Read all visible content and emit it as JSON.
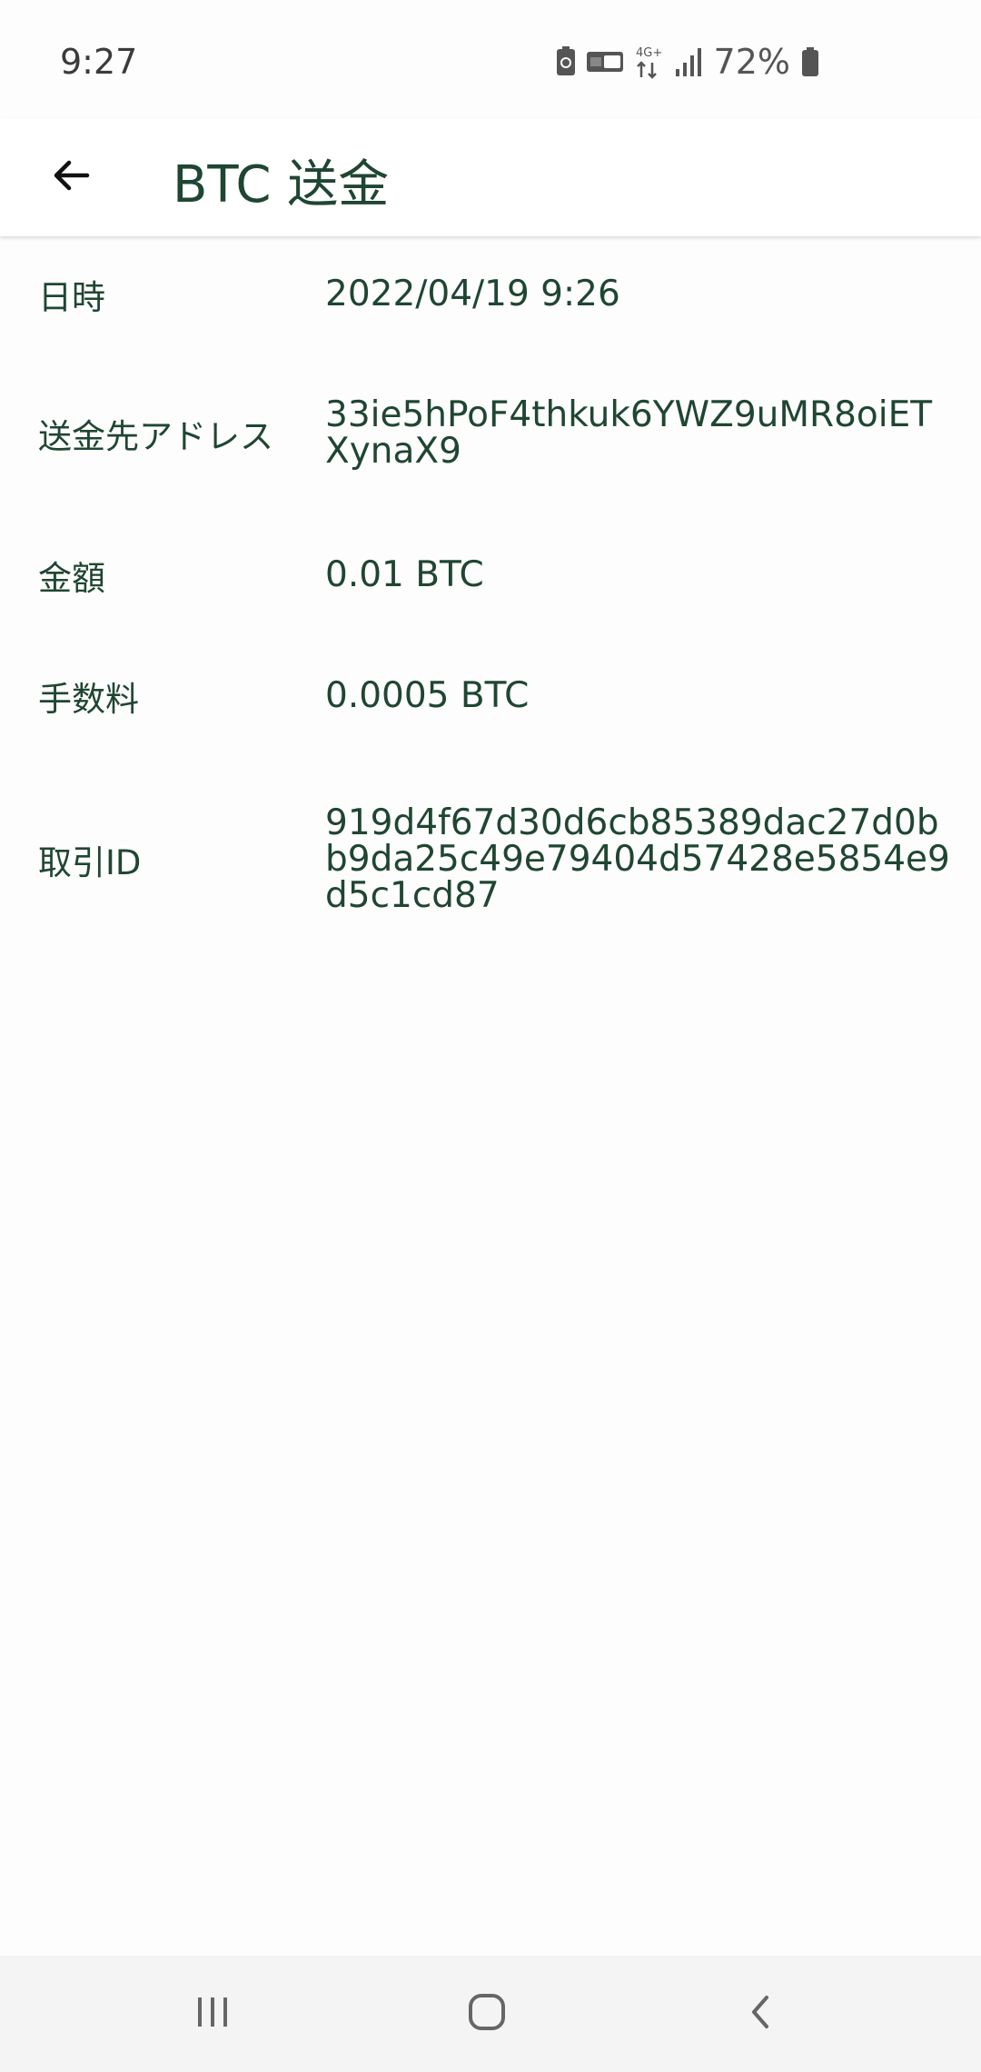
{
  "status_bar": {
    "time": "9:27",
    "battery_percent": "72%",
    "network_label": "4G+",
    "icons": [
      "sim-icon",
      "volte-icon",
      "network-4g-icon",
      "signal-icon",
      "battery-icon"
    ]
  },
  "app_bar": {
    "title": "BTC 送金",
    "back_icon": "arrow-back-icon"
  },
  "details": {
    "date_label": "日時",
    "date_value": "2022/04/19 9:26",
    "address_label": "送金先アドレス",
    "address_value": "33ie5hPoF4thkuk6YWZ9uMR8oiETXynaX9",
    "amount_label": "金額",
    "amount_value": "0.01 BTC",
    "fee_label": "手数料",
    "fee_value": "0.0005 BTC",
    "txid_label": "取引ID",
    "txid_value": "919d4f67d30d6cb85389dac27d0bb9da25c49e79404d57428e5854e9d5c1cd87"
  },
  "nav_bar": {
    "icons": [
      "recent-apps-icon",
      "home-icon",
      "back-icon"
    ]
  },
  "colors": {
    "accent": "#1f4632",
    "background": "#fdfdfd",
    "nav_background": "#f4f4f4"
  }
}
